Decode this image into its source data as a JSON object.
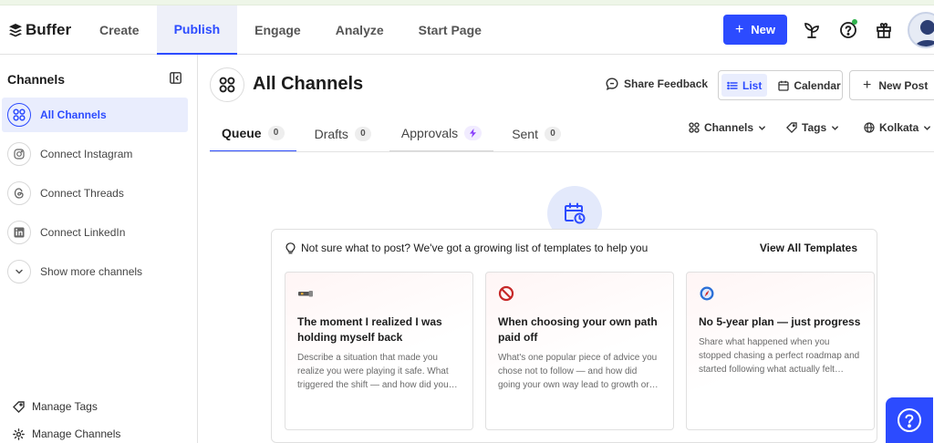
{
  "brand": {
    "name": "Buffer"
  },
  "nav": {
    "items": [
      {
        "label": "Create"
      },
      {
        "label": "Publish"
      },
      {
        "label": "Engage"
      },
      {
        "label": "Analyze"
      },
      {
        "label": "Start Page"
      }
    ],
    "active": "Publish",
    "new_label": "New"
  },
  "sidebar": {
    "title": "Channels",
    "items": [
      {
        "label": "All Channels",
        "icon": "grid-icon",
        "active": true
      },
      {
        "label": "Connect Instagram",
        "icon": "instagram-icon"
      },
      {
        "label": "Connect Threads",
        "icon": "threads-icon"
      },
      {
        "label": "Connect LinkedIn",
        "icon": "linkedin-icon"
      },
      {
        "label": "Show more channels",
        "icon": "chevron-down-icon"
      }
    ],
    "bottom": [
      {
        "label": "Manage Tags",
        "icon": "tag-icon"
      },
      {
        "label": "Manage Channels",
        "icon": "gear-icon"
      }
    ]
  },
  "header": {
    "title": "All Channels",
    "share_feedback": "Share Feedback",
    "view_list": "List",
    "view_calendar": "Calendar",
    "new_post": "New Post"
  },
  "tabs": [
    {
      "label": "Queue",
      "count": "0"
    },
    {
      "label": "Drafts",
      "count": "0"
    },
    {
      "label": "Approvals"
    },
    {
      "label": "Sent",
      "count": "0"
    }
  ],
  "filters": {
    "channels": "Channels",
    "tags": "Tags",
    "timezone": "Kolkata"
  },
  "templates": {
    "heading": "Not sure what to post? We've got a growing list of templates to help you",
    "view_all": "View All Templates",
    "cards": [
      {
        "title": "The moment I realized I was holding myself back",
        "description": "Describe a situation that made you realize you were playing it safe. What triggered the shift — and how did you…",
        "icon": "flashlight-icon"
      },
      {
        "title": "When choosing your own path paid off",
        "description": "What's one popular piece of advice you chose not to follow — and how did going your own way lead to growth or…",
        "icon": "prohibited-icon"
      },
      {
        "title": "No 5-year plan — just progress",
        "description": "Share what happened when you stopped chasing a perfect roadmap and started following what actually felt…",
        "icon": "compass-icon"
      }
    ]
  },
  "colors": {
    "accent": "#2c4bff",
    "accent_soft": "#e9edfd"
  }
}
